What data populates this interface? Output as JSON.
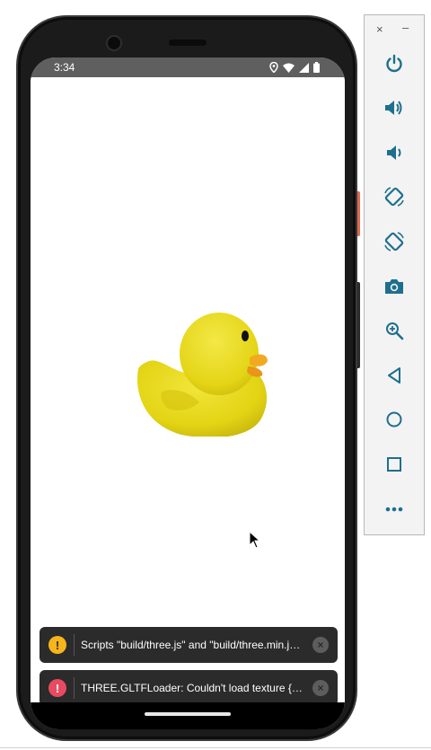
{
  "status_bar": {
    "time": "3:34",
    "icons": [
      "location-icon",
      "wifi-icon",
      "signal-icon",
      "battery-icon"
    ]
  },
  "toasts": [
    {
      "type": "warning",
      "icon": "!",
      "text": "Scripts \"build/three.js\" and \"build/three.min.js\" are deprecated"
    },
    {
      "type": "error",
      "icon": "!",
      "text": "THREE.GLTFLoader: Couldn't load texture {\"uri\":\"...\"}"
    }
  ],
  "toast_close": "×",
  "emulator": {
    "close": "×",
    "minimize": "–",
    "controls": [
      "power-icon",
      "volume-up-icon",
      "volume-down-icon",
      "rotate-left-icon",
      "rotate-right-icon",
      "camera-icon",
      "zoom-icon",
      "back-icon",
      "home-icon",
      "overview-icon",
      "more-icon"
    ]
  },
  "colors": {
    "duck": "#e8d818",
    "beak": "#f2a922",
    "warning": "#f5b51b",
    "error": "#e64b62",
    "emulator_icons": "#1e6f8e"
  }
}
